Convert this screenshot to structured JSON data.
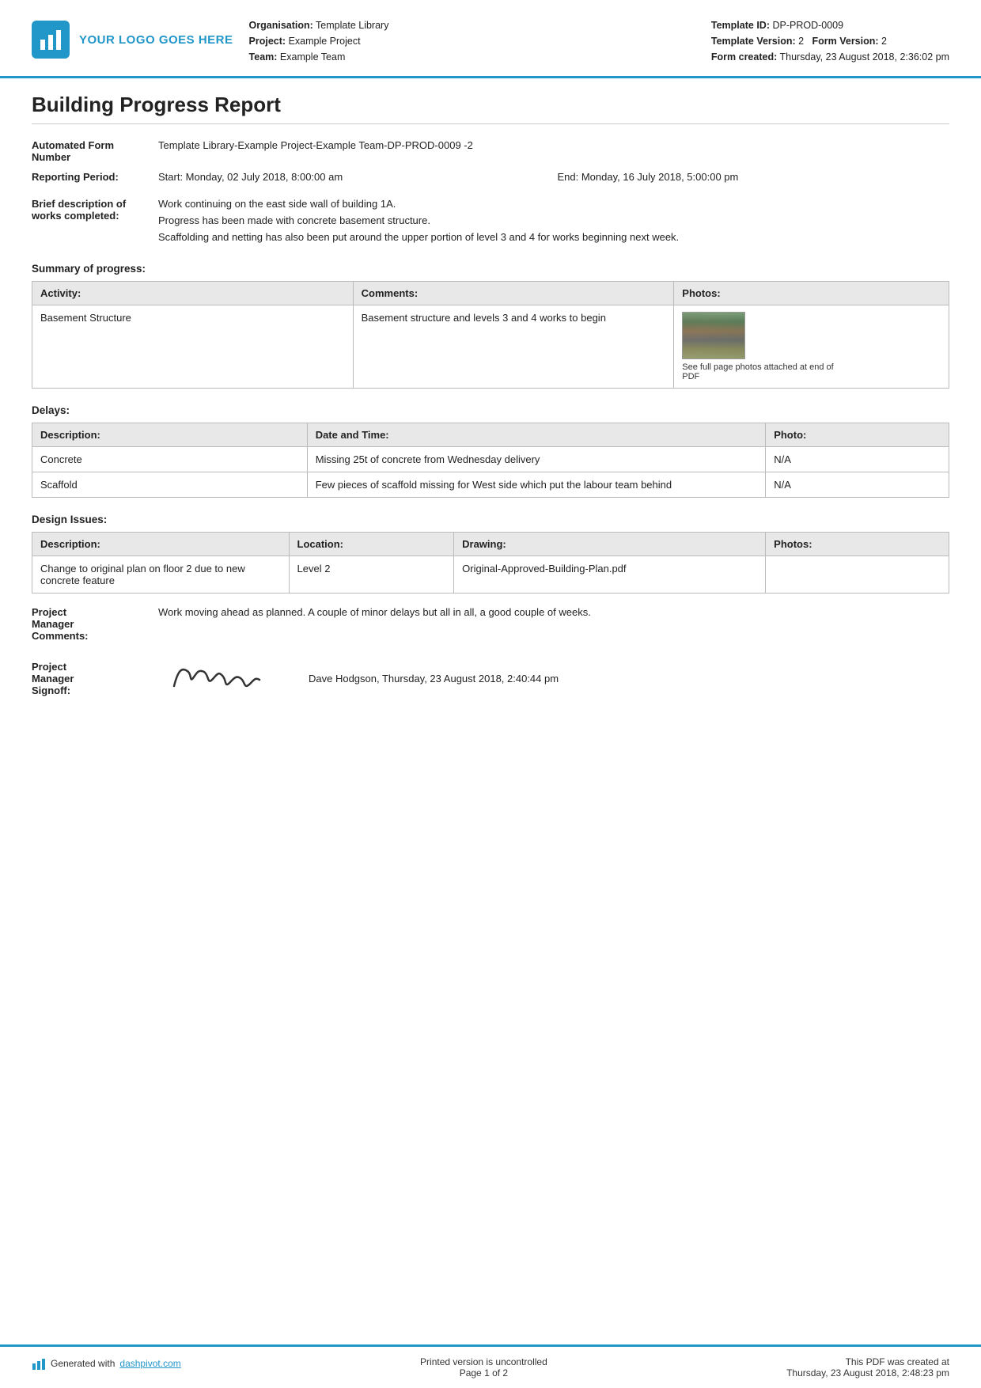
{
  "header": {
    "logo_text": "YOUR LOGO GOES HERE",
    "meta_left": {
      "organisation_label": "Organisation:",
      "organisation_value": "Template Library",
      "project_label": "Project:",
      "project_value": "Example Project",
      "team_label": "Team:",
      "team_value": "Example Team"
    },
    "meta_right": {
      "template_id_label": "Template ID:",
      "template_id_value": "DP-PROD-0009",
      "template_version_label": "Template Version:",
      "template_version_value": "2",
      "form_version_label": "Form Version:",
      "form_version_value": "2",
      "form_created_label": "Form created:",
      "form_created_value": "Thursday, 23 August 2018, 2:36:02 pm"
    }
  },
  "report": {
    "title": "Building Progress Report",
    "automated_form_number_label": "Automated Form Number",
    "automated_form_number_value": "Template Library-Example Project-Example Team-DP-PROD-0009   -2",
    "reporting_period_label": "Reporting Period:",
    "reporting_start": "Start: Monday, 02 July 2018, 8:00:00 am",
    "reporting_end": "End: Monday, 16 July 2018, 5:00:00 pm",
    "brief_desc_label": "Brief description of works completed:",
    "brief_desc_lines": [
      "Work continuing on the east side wall of building 1A.",
      "Progress has been made with concrete basement structure.",
      "Scaffolding and netting has also been put around the upper portion of level 3 and 4 for works beginning next week."
    ],
    "summary_section_title": "Summary of progress:",
    "summary_table": {
      "headers": [
        "Activity:",
        "Comments:",
        "Photos:"
      ],
      "rows": [
        {
          "activity": "Basement Structure",
          "comments": "Basement structure and levels 3 and 4 works to begin",
          "photo_caption": "See full page photos attached at end of PDF"
        }
      ]
    },
    "delays_section_title": "Delays:",
    "delays_table": {
      "headers": [
        "Description:",
        "Date and Time:",
        "Photo:"
      ],
      "rows": [
        {
          "description": "Concrete",
          "date_time": "Missing 25t of concrete from Wednesday delivery",
          "photo": "N/A"
        },
        {
          "description": "Scaffold",
          "date_time": "Few pieces of scaffold missing for West side which put the labour team behind",
          "photo": "N/A"
        }
      ]
    },
    "design_issues_section_title": "Design Issues:",
    "design_issues_table": {
      "headers": [
        "Description:",
        "Location:",
        "Drawing:",
        "Photos:"
      ],
      "rows": [
        {
          "description": "Change to original plan on floor 2 due to new concrete feature",
          "location": "Level 2",
          "drawing": "Original-Approved-Building-Plan.pdf",
          "photos": ""
        }
      ]
    },
    "pm_comments_label": "Project Manager Comments:",
    "pm_comments_value": "Work moving ahead as planned. A couple of minor delays but all in all, a good couple of weeks.",
    "pm_signoff_label": "Project Manager Signoff:",
    "pm_signoff_name": "Dave Hodgson, Thursday, 23 August 2018, 2:40:44 pm"
  },
  "footer": {
    "generated_text": "Generated with",
    "generated_link": "dashpivot.com",
    "printed_notice": "Printed version is uncontrolled",
    "page_text": "Page 1",
    "of_text": "of 2",
    "pdf_created_label": "This PDF was created at",
    "pdf_created_value": "Thursday, 23 August 2018, 2:48:23 pm"
  }
}
